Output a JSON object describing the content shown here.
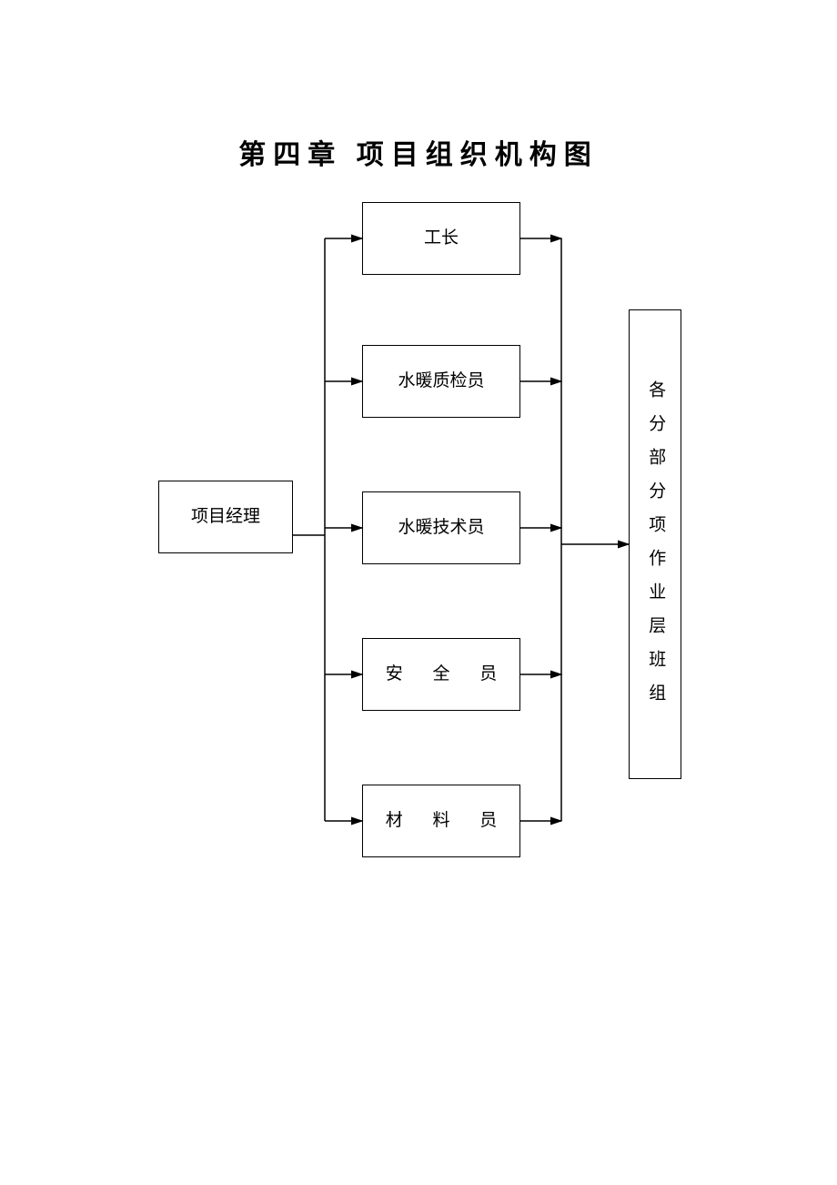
{
  "title": "第四章  项目组织机构图",
  "boxes": {
    "manager": "项目经理",
    "mid1": "工长",
    "mid2": "水暖质检员",
    "mid3": "水暖技术员",
    "mid4": "安 全 员",
    "mid5": "材 料 员",
    "right": "各分部分项作业层班组"
  }
}
